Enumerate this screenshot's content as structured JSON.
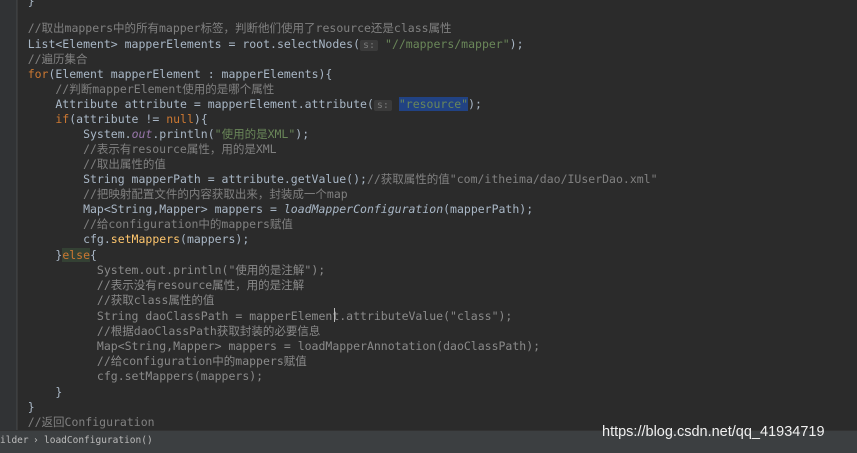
{
  "code_lines": [
    "    }",
    "    //取出mappers中的所有mapper标签，判断他们使用了resource还是class属性",
    "    List<Element> mapperElements = root.selectNodes(",
    "s:",
    "\"//mappers/mapper\"",
    ");",
    "    //遍历集合",
    "    for",
    "(Element mapperElement : mapperElements){",
    "        //判断mapperElement使用的是哪个属性",
    "        Attribute attribute = mapperElement.attribute(",
    "s:",
    "\"resource\"",
    ");",
    "        if",
    "(attribute != ",
    "null",
    "){",
    "            System.",
    "out",
    ".println(",
    "\"使用的是XML\"",
    ");",
    "            //表示有resource属性，用的是XML",
    "            //取出属性的值",
    "            String mapperPath = attribute.getValue();",
    "//获取属性的值\"com/itheima/dao/IUserDao.xml\"",
    "            //把映射配置文件的内容获取出来，封装成一个map",
    "            Map<String,Mapper> mappers = ",
    "loadMapperConfiguration",
    "(mapperPath);",
    "            //给configuration中的mappers赋值",
    "            cfg.",
    "setMappers",
    "(mappers);",
    "        }",
    "else",
    "{",
    "              System.out.println(\"使用的是注解\");",
    "              //表示没有resource属性，用的是注解",
    "              //获取class属性的值",
    "              String daoClassPath = mapperElement.attributeValue(\"class\");",
    "              //根据daoClassPath获取封装的必要信息",
    "              Map<String,Mapper> mappers = loadMapperAnnotation(daoClassPath);",
    "              //给configuration中的mappers赋值",
    "              cfg.setMappers(mappers);",
    "        }",
    "    }",
    "    //返回Configuration"
  ],
  "status": {
    "breadcrumb_left": "ilder",
    "breadcrumb_sep": "›",
    "breadcrumb_method": "loadConfiguration()"
  },
  "watermark": "https://blog.csdn.net/qq_41934719",
  "colors": {
    "background": "#2b2b2b",
    "keyword": "#cc7832",
    "comment": "#808080",
    "string": "#6a8759",
    "field": "#9876aa",
    "method": "#ffc66d",
    "text": "#a9b7c6"
  }
}
